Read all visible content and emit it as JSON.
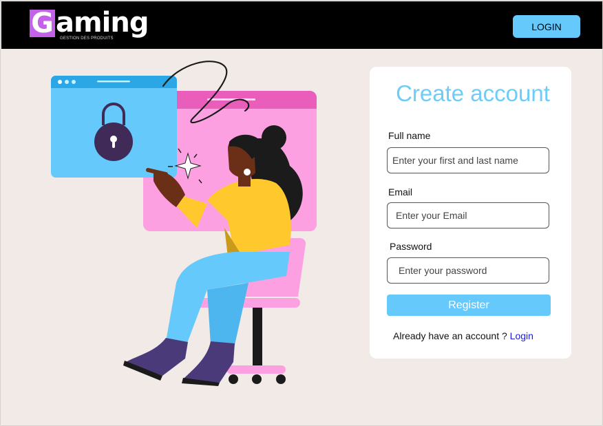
{
  "header": {
    "logo_letter": "G",
    "logo_rest": "aming",
    "logo_subtitle": "GESTION DES PRODUITS",
    "login_button": "LOGIN"
  },
  "form": {
    "title": "Create account",
    "full_name_label": "Full name",
    "full_name_placeholder": "Enter your first and last name",
    "email_label": "Email",
    "email_placeholder": "Enter your Email",
    "password_label": "Password",
    "password_placeholder": "Enter your password",
    "register_button": "Register",
    "already_text": "Already have an account ?",
    "login_link": "Login"
  },
  "colors": {
    "accent": "#65c9fb",
    "logo_purple": "#c361e8",
    "header_bg": "#000000",
    "page_bg": "#f1eae7"
  }
}
